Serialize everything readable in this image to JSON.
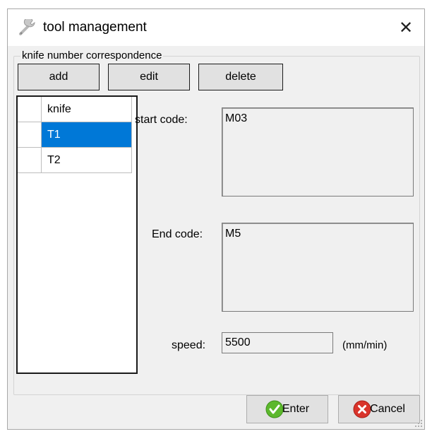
{
  "window": {
    "title": "tool management",
    "close_symbol": "✕",
    "title_icon": "wrench-icon"
  },
  "group": {
    "title": "knife number correspondence"
  },
  "toolbar": {
    "add_label": "add",
    "edit_label": "edit",
    "delete_label": "delete"
  },
  "knife_list": {
    "header": "knife",
    "rows": [
      {
        "label": "T1",
        "selected": true
      },
      {
        "label": "T2",
        "selected": false
      }
    ]
  },
  "form": {
    "start_code_label": "start code:",
    "start_code_value": "M03",
    "end_code_label": "End code:",
    "end_code_value": "M5",
    "speed_label": "speed:",
    "speed_value": "5500",
    "speed_unit": "(mm/min)"
  },
  "footer": {
    "enter_label": "Enter",
    "cancel_label": "Cancel",
    "enter_icon": "check-icon",
    "cancel_icon": "x-circle-icon"
  },
  "colors": {
    "selection": "#0078d7",
    "button_face": "#e1e1e1",
    "window_bg": "#f0f0f0",
    "enter_icon": "#5cb82c",
    "cancel_icon": "#d9342b"
  }
}
